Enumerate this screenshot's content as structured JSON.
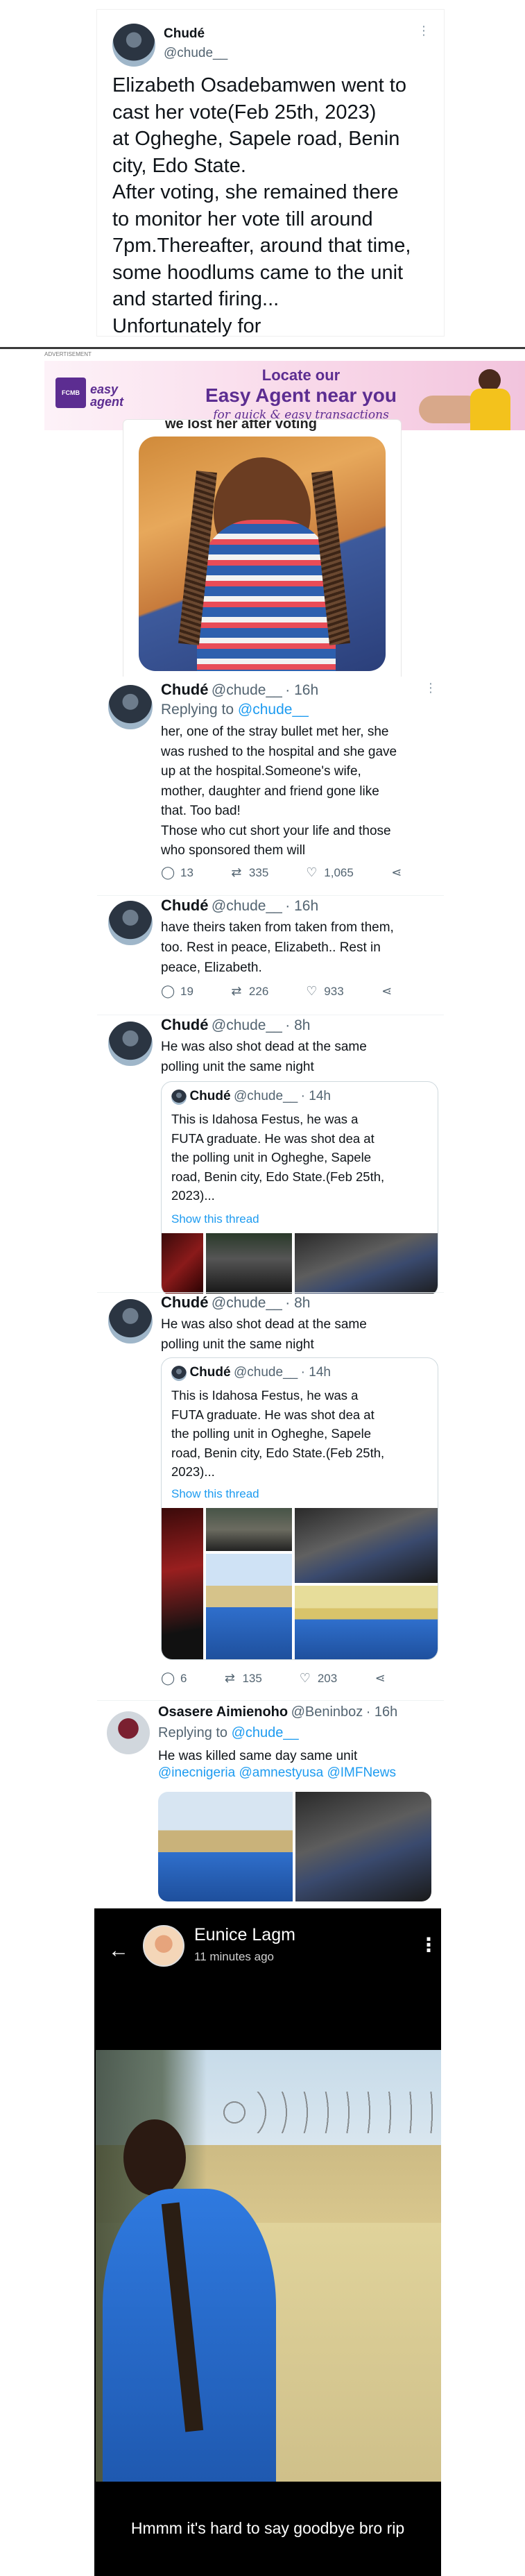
{
  "tweet1": {
    "name": "Chudé",
    "handle": "@chude__",
    "lines": [
      "Elizabeth Osadebamwen went to",
      "cast her vote(Feb 25th, 2023)",
      "at Ogheghe,  Sapele road, Benin",
      "city, Edo State.",
      "After voting, she remained there",
      "to monitor her vote till around",
      "7pm.Thereafter, around that time,",
      "some hoodlums came to the unit",
      "and started firing...",
      "Unfortunately for"
    ]
  },
  "ad": {
    "label": "ADVERTISEMENT",
    "brand": "FCMB",
    "product": "easy agent",
    "line1": "Locate our",
    "line2": "Easy Agent near you",
    "line3": "for quick & easy transactions",
    "photo_caption": "we lost her after voting"
  },
  "tweet2": {
    "name": "Chudé",
    "handle": "@chude__",
    "time": "· 16h",
    "replying_prefix": "Replying to",
    "replying_to": "@chude__",
    "lines": [
      "her, one of the stray bullet met her, she",
      "was rushed to the hospital and she gave",
      "up at the hospital.Someone's wife,",
      "mother, daughter and friend gone like",
      "that. Too bad!",
      "Those who cut short your life and those",
      "who sponsored them will"
    ],
    "replies": "13",
    "retweets": "335",
    "likes": "1,065"
  },
  "tweet3": {
    "name": "Chudé",
    "handle": "@chude__",
    "time": "· 16h",
    "lines": [
      "have theirs taken from taken from them,",
      "too. Rest in peace, Elizabeth.. Rest in",
      "peace, Elizabeth."
    ],
    "replies": "19",
    "retweets": "226",
    "likes": "933"
  },
  "tweet4": {
    "name": "Chudé",
    "handle": "@chude__",
    "time": "· 8h",
    "lines": [
      "He was also shot dead at the same",
      "polling unit the same night"
    ],
    "quote": {
      "name": "Chudé",
      "handle": "@chude__",
      "time": "· 14h",
      "lines": [
        "This is Idahosa Festus, he was a",
        "FUTA graduate. He was shot dea at",
        "the polling unit in Ogheghe, Sapele",
        "road, Benin city, Edo State.(Feb 25th,",
        "2023)..."
      ],
      "show_thread": "Show this thread"
    }
  },
  "tweet5": {
    "name": "Chudé",
    "handle": "@chude__",
    "time": "· 8h",
    "lines": [
      "He was also shot dead at the same",
      "polling unit the same night"
    ],
    "quote": {
      "name": "Chudé",
      "handle": "@chude__",
      "time": "· 14h",
      "lines": [
        "This is Idahosa Festus, he was a",
        "FUTA graduate. He was shot dea at",
        "the polling unit in Ogheghe, Sapele",
        "road, Benin city, Edo State.(Feb 25th,",
        "2023)..."
      ],
      "show_thread": "Show this thread"
    },
    "replies": "6",
    "retweets": "135",
    "likes": "203"
  },
  "tweet6": {
    "name": "Osasere Aimienoho",
    "handle": "@Beninboz",
    "time": "· 16h",
    "replying_prefix": "Replying to",
    "replying_to": "@chude__",
    "text": "He was killed same day same unit",
    "mentions": "@inecnigeria @amnestyusa @IMFNews"
  },
  "status": {
    "name": "Eunice Lagm",
    "time": "11 minutes ago",
    "caption": "Hmmm it's hard to say goodbye bro rip"
  },
  "icons": {
    "reply": "reply-icon",
    "retweet": "retweet-icon",
    "like": "heart-icon",
    "share": "share-icon",
    "back": "back-arrow-icon",
    "more": "more-vertical-icon"
  },
  "colors": {
    "link": "#1d9bf0",
    "ad_purple": "#5c2d91",
    "ad_pink": "#f6d1e4"
  }
}
